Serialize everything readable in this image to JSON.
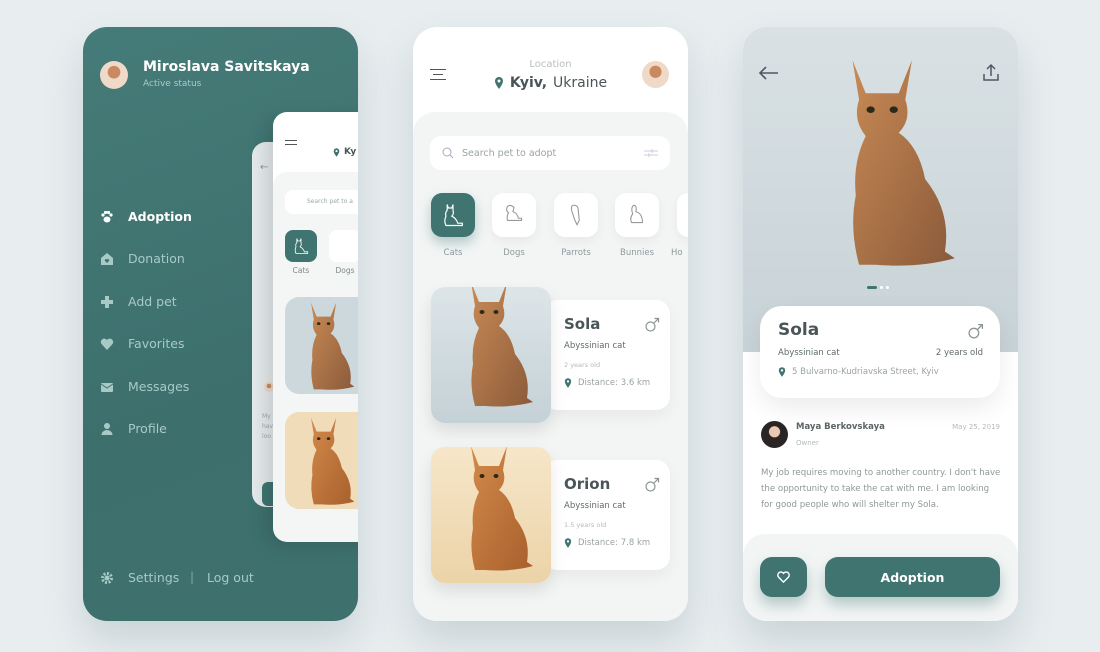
{
  "colors": {
    "accent": "#3f7471",
    "background": "#e8eef0"
  },
  "drawer": {
    "user_name": "Miroslava Savitskaya",
    "status": "Active status",
    "items": [
      {
        "label": "Adoption",
        "icon": "paw-icon",
        "active": true
      },
      {
        "label": "Donation",
        "icon": "home-heart-icon"
      },
      {
        "label": "Add pet",
        "icon": "plus-icon"
      },
      {
        "label": "Favorites",
        "icon": "heart-icon"
      },
      {
        "label": "Messages",
        "icon": "mail-icon"
      },
      {
        "label": "Profile",
        "icon": "user-icon"
      }
    ],
    "settings": "Settings",
    "separator": "|",
    "logout": "Log out",
    "preview": {
      "location": "Ky",
      "search": "Search pet to a",
      "cats": "Cats",
      "dogs": "Dogs",
      "desc": "My\nhav\nloo"
    }
  },
  "home": {
    "location_label": "Location",
    "city": "Kyiv,",
    "country": "Ukraine",
    "search_placeholder": "Search pet to adopt",
    "categories": [
      {
        "label": "Cats",
        "selected": true
      },
      {
        "label": "Dogs"
      },
      {
        "label": "Parrots"
      },
      {
        "label": "Bunnies"
      },
      {
        "label": "Ho"
      }
    ],
    "pets": [
      {
        "name": "Sola",
        "breed": "Abyssinian cat",
        "age": "2 years old",
        "distance": "Distance: 3.6 km",
        "gender": "male"
      },
      {
        "name": "Orion",
        "breed": "Abyssinian cat",
        "age": "1.5 years old",
        "distance": "Distance: 7.8 km",
        "gender": "male"
      }
    ]
  },
  "detail": {
    "name": "Sola",
    "breed": "Abyssinian cat",
    "age": "2 years old",
    "address": "5 Bulvarno-Kudriavska Street, Kyiv",
    "owner_name": "Maya Berkovskaya",
    "owner_role": "Owner",
    "date": "May 25, 2019",
    "description": "My job requires moving to another country. I don't have the opportunity to take the cat with me. I am looking for good people who will shelter my Sola.",
    "adopt_button": "Adoption",
    "image_page": 1,
    "image_count": 3
  }
}
